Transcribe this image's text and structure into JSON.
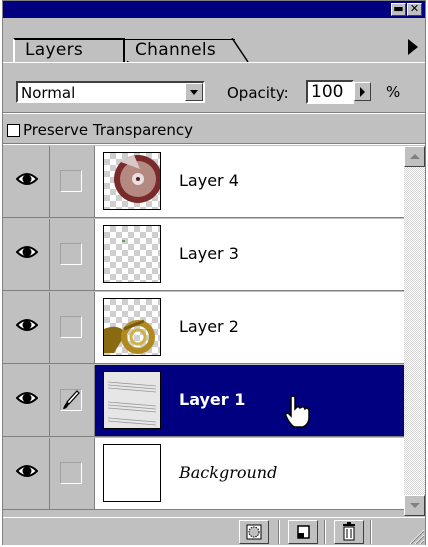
{
  "window": {
    "minimize_glyph": "▬",
    "close_glyph": "✕"
  },
  "tabs": [
    {
      "label": "Layers",
      "active": true
    },
    {
      "label": "Channels",
      "active": false
    }
  ],
  "panel_menu_icon": "panel-menu-arrow-icon",
  "blend": {
    "mode": "Normal",
    "opacity_label": "Opacity:",
    "opacity_value": "100",
    "opacity_unit": "%"
  },
  "preserve_transparency": {
    "label": "Preserve Transparency",
    "checked": false
  },
  "layers": [
    {
      "name": "Layer 4",
      "visible": true,
      "editing": false,
      "selected": false,
      "thumb": "disc-on-transparency"
    },
    {
      "name": "Layer 3",
      "visible": true,
      "editing": false,
      "selected": false,
      "thumb": "transparency"
    },
    {
      "name": "Layer 2",
      "visible": true,
      "editing": false,
      "selected": false,
      "thumb": "french-horn-on-transparency"
    },
    {
      "name": "Layer 1",
      "visible": true,
      "editing": true,
      "selected": true,
      "thumb": "sheet-music"
    },
    {
      "name": "Background",
      "visible": true,
      "editing": false,
      "selected": false,
      "thumb": "white"
    }
  ],
  "bottom_buttons": [
    {
      "name": "layer-mask-button",
      "icon": "mask-icon"
    },
    {
      "name": "new-layer-button",
      "icon": "new-layer-icon"
    },
    {
      "name": "delete-layer-button",
      "icon": "trash-icon"
    }
  ],
  "colors": {
    "title_bar": "#000080",
    "selection": "#000080",
    "panel": "#c0c0c0"
  }
}
